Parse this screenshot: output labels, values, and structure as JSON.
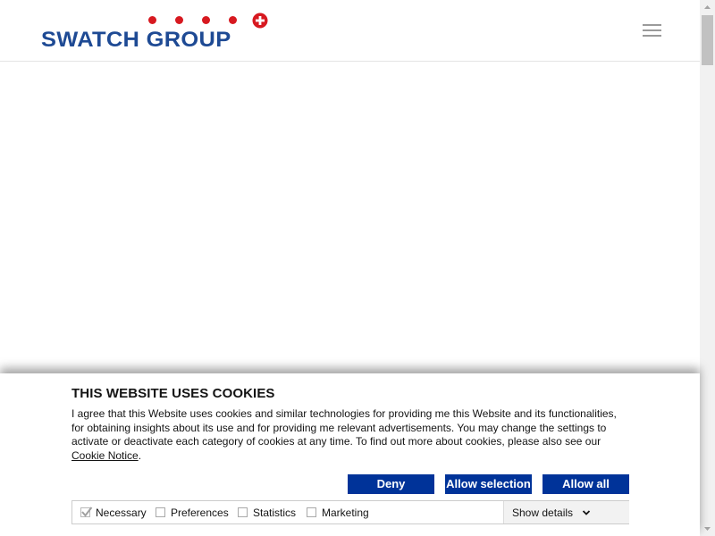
{
  "header": {
    "logo_text": "SWATCH GROUP",
    "brand_blue": "#1e4a94",
    "brand_red": "#d71920",
    "menu_icon": "hamburger-icon"
  },
  "cookie_dialog": {
    "title": "THIS WEBSITE USES COOKIES",
    "body": "I agree that this Website uses cookies and similar technologies for providing me this Website and its functionalities, for obtaining insights about its use and for providing me relevant advertisements. You may change the settings to activate or deactivate each category of cookies at any time. To find out more about cookies, please also see our ",
    "link_text": "Cookie Notice",
    "body_end": ".",
    "buttons": {
      "deny": "Deny",
      "allow_selection": "Allow selection",
      "allow_all": "Allow all"
    },
    "button_color": "#003399",
    "categories": [
      {
        "label": "Necessary",
        "checked": true,
        "disabled": true
      },
      {
        "label": "Preferences",
        "checked": false
      },
      {
        "label": "Statistics",
        "checked": false
      },
      {
        "label": "Marketing",
        "checked": false
      }
    ],
    "show_details": "Show details"
  }
}
